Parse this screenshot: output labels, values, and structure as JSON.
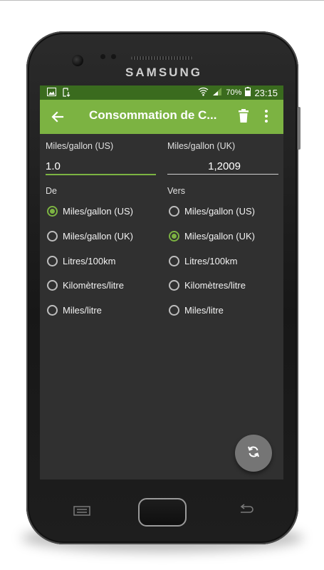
{
  "device": {
    "brand": "SAMSUNG"
  },
  "status_bar": {
    "battery": "70%",
    "time": "23:15",
    "icons": [
      "image-icon",
      "download-icon",
      "wifi-icon",
      "signal-icon",
      "battery-icon"
    ]
  },
  "toolbar": {
    "title": "Consommation de C...",
    "back_icon": "arrow-back-icon",
    "delete_icon": "trash-icon",
    "more_icon": "more-vertical-icon"
  },
  "converter": {
    "from_field": {
      "label": "Miles/gallon (US)",
      "value": "1.0"
    },
    "to_field": {
      "label": "Miles/gallon (UK)",
      "value": "1,2009"
    },
    "from_section": {
      "label": "De",
      "selected": "Miles/gallon (US)"
    },
    "to_section": {
      "label": "Vers",
      "selected": "Miles/gallon (UK)"
    },
    "units": [
      "Miles/gallon (US)",
      "Miles/gallon (UK)",
      "Litres/100km",
      "Kilomètres/litre",
      "Miles/litre"
    ]
  },
  "fab": {
    "icon": "swap-refresh-icon"
  },
  "colors": {
    "accent": "#7cb342",
    "status_bar": "#3a6b1e",
    "background": "#303030"
  }
}
